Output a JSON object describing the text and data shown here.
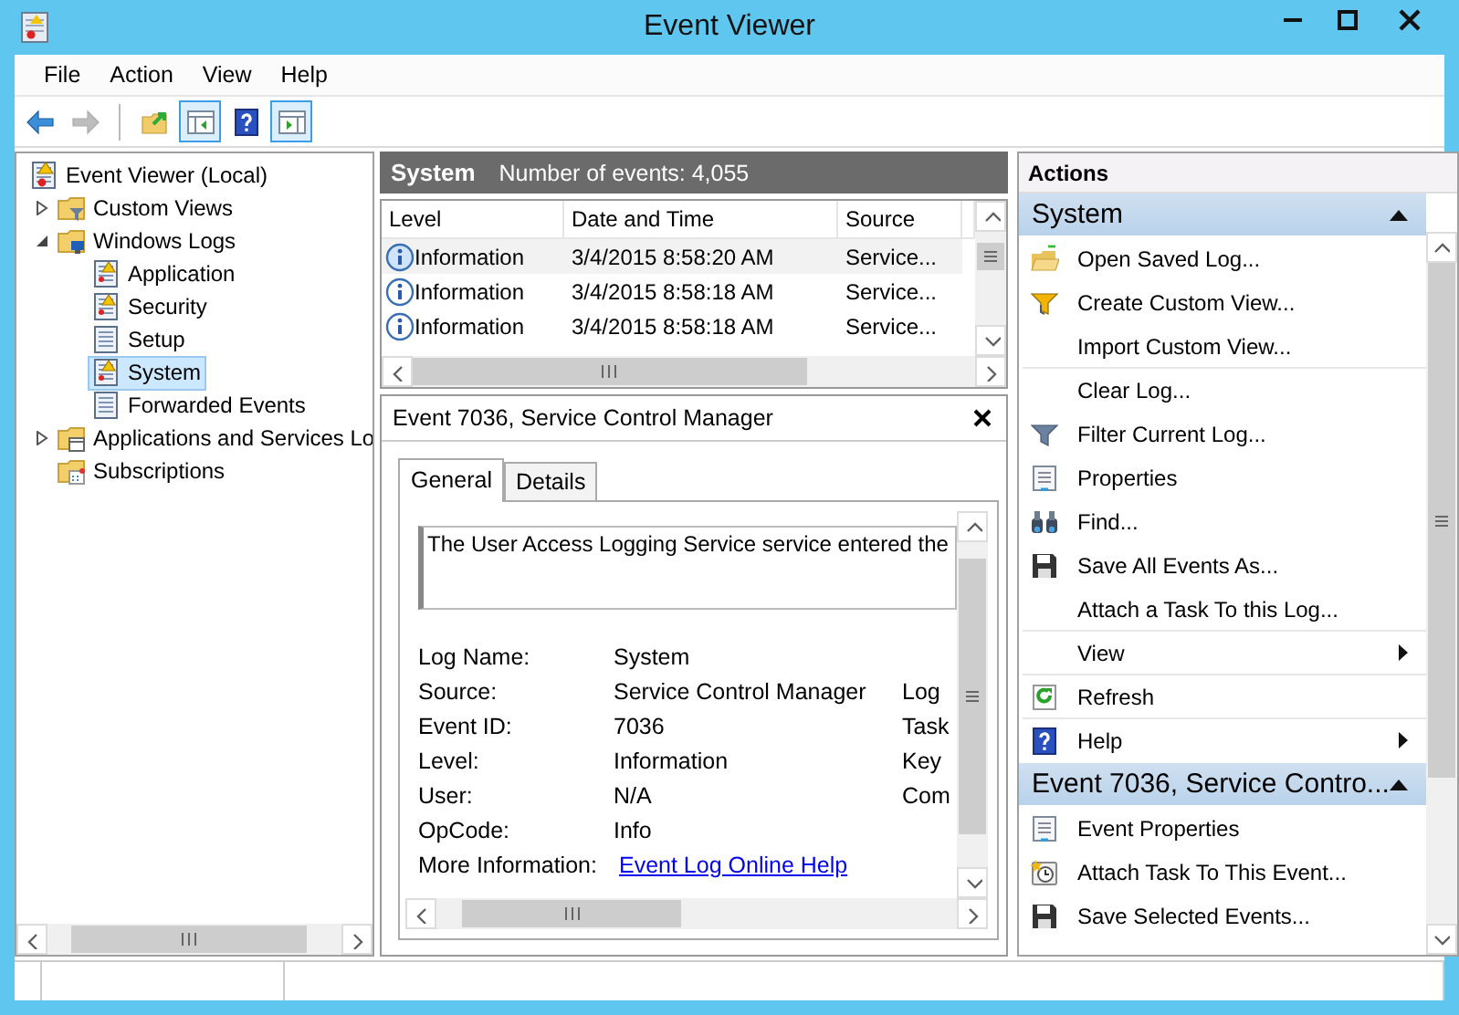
{
  "window": {
    "title": "Event Viewer"
  },
  "menu": [
    "File",
    "Action",
    "View",
    "Help"
  ],
  "toolbar": [
    {
      "kind": "back",
      "disabled": false,
      "pressed": false
    },
    {
      "kind": "forward",
      "disabled": true,
      "pressed": false
    },
    {
      "kind": "separator"
    },
    {
      "kind": "open-log",
      "disabled": false,
      "pressed": false
    },
    {
      "kind": "tree-toggle",
      "disabled": false,
      "pressed": true
    },
    {
      "kind": "help",
      "disabled": false,
      "pressed": false
    },
    {
      "kind": "action-toggle",
      "disabled": false,
      "pressed": true
    }
  ],
  "tree": {
    "items": [
      {
        "label": "Event Viewer (Local)",
        "kind": "root",
        "selected": false,
        "children": [
          {
            "label": "Custom Views",
            "kind": "views",
            "expanded": false,
            "selected": false
          },
          {
            "label": "Windows Logs",
            "kind": "logs",
            "expanded": true,
            "selected": false,
            "children": [
              {
                "label": "Application",
                "kind": "warnlog",
                "selected": false
              },
              {
                "label": "Security",
                "kind": "warnlog",
                "selected": false
              },
              {
                "label": "Setup",
                "kind": "log",
                "selected": false
              },
              {
                "label": "System",
                "kind": "warnlog",
                "selected": true
              },
              {
                "label": "Forwarded Events",
                "kind": "log",
                "selected": false
              }
            ]
          },
          {
            "label": "Applications and Services Lo",
            "kind": "services",
            "expanded": false,
            "selected": false
          },
          {
            "label": "Subscriptions",
            "kind": "subscriptions",
            "selected": false
          }
        ]
      }
    ]
  },
  "events": {
    "title": "System",
    "count": "Number of events: 4,055",
    "columns": [
      "Level",
      "Date and Time",
      "Source"
    ],
    "rows": [
      {
        "level": "Information",
        "time": "3/4/2015 8:58:20 AM",
        "source": "Service...",
        "selected": true
      },
      {
        "level": "Information",
        "time": "3/4/2015 8:58:18 AM",
        "source": "Service...",
        "selected": false
      },
      {
        "level": "Information",
        "time": "3/4/2015 8:58:18 AM",
        "source": "Service...",
        "selected": false
      }
    ]
  },
  "detail": {
    "title": "Event 7036, Service Control Manager",
    "tabs": [
      {
        "label": "General",
        "selected": true
      },
      {
        "label": "Details",
        "selected": false
      }
    ],
    "message": "The User Access Logging Service service entered the",
    "fields": [
      {
        "label": "Log Name:",
        "value": "System",
        "kind": "text"
      },
      {
        "label": "Source:",
        "value": "Service Control Manager",
        "kind": "text"
      },
      {
        "label": "Event ID:",
        "value": "7036",
        "kind": "text"
      },
      {
        "label": "Level:",
        "value": "Information",
        "kind": "text"
      },
      {
        "label": "User:",
        "value": "N/A",
        "kind": "text"
      },
      {
        "label": "OpCode:",
        "value": "Info",
        "kind": "text"
      },
      {
        "label": "More Information:",
        "value": "Event Log Online Help",
        "kind": "link"
      }
    ],
    "column_3": [
      "Log",
      "Task",
      "Key",
      "Com"
    ]
  },
  "actions": {
    "title": "Actions",
    "sections": [
      {
        "title": "System",
        "expanded": true,
        "items": [
          {
            "label": "Open Saved Log...",
            "kind": "open",
            "submenu": false,
            "divider_after": false
          },
          {
            "label": "Create Custom View...",
            "kind": "create",
            "submenu": false,
            "divider_after": false
          },
          {
            "label": "Import Custom View...",
            "kind": "plain",
            "submenu": false,
            "divider_after": true
          },
          {
            "label": "Clear Log...",
            "kind": "plain",
            "submenu": false,
            "divider_after": false
          },
          {
            "label": "Filter Current Log...",
            "kind": "filter",
            "submenu": false,
            "divider_after": false
          },
          {
            "label": "Properties",
            "kind": "properties",
            "submenu": false,
            "divider_after": false
          },
          {
            "label": "Find...",
            "kind": "find",
            "submenu": false,
            "divider_after": false
          },
          {
            "label": "Save All Events As...",
            "kind": "save",
            "submenu": false,
            "divider_after": false
          },
          {
            "label": "Attach a Task To this Log...",
            "kind": "plain",
            "submenu": false,
            "divider_after": true
          },
          {
            "label": "View",
            "kind": "plain",
            "submenu": true,
            "divider_after": true
          },
          {
            "label": "Refresh",
            "kind": "refresh",
            "submenu": false,
            "divider_after": true
          },
          {
            "label": "Help",
            "kind": "help",
            "submenu": true,
            "divider_after": false
          }
        ]
      },
      {
        "title": "Event 7036, Service Contro...",
        "expanded": true,
        "items": [
          {
            "label": "Event Properties",
            "kind": "properties",
            "submenu": false,
            "divider_after": false
          },
          {
            "label": "Attach Task To This Event...",
            "kind": "attach",
            "submenu": false,
            "divider_after": false
          },
          {
            "label": "Save Selected Events...",
            "kind": "save",
            "submenu": false,
            "divider_after": false
          }
        ]
      }
    ]
  }
}
